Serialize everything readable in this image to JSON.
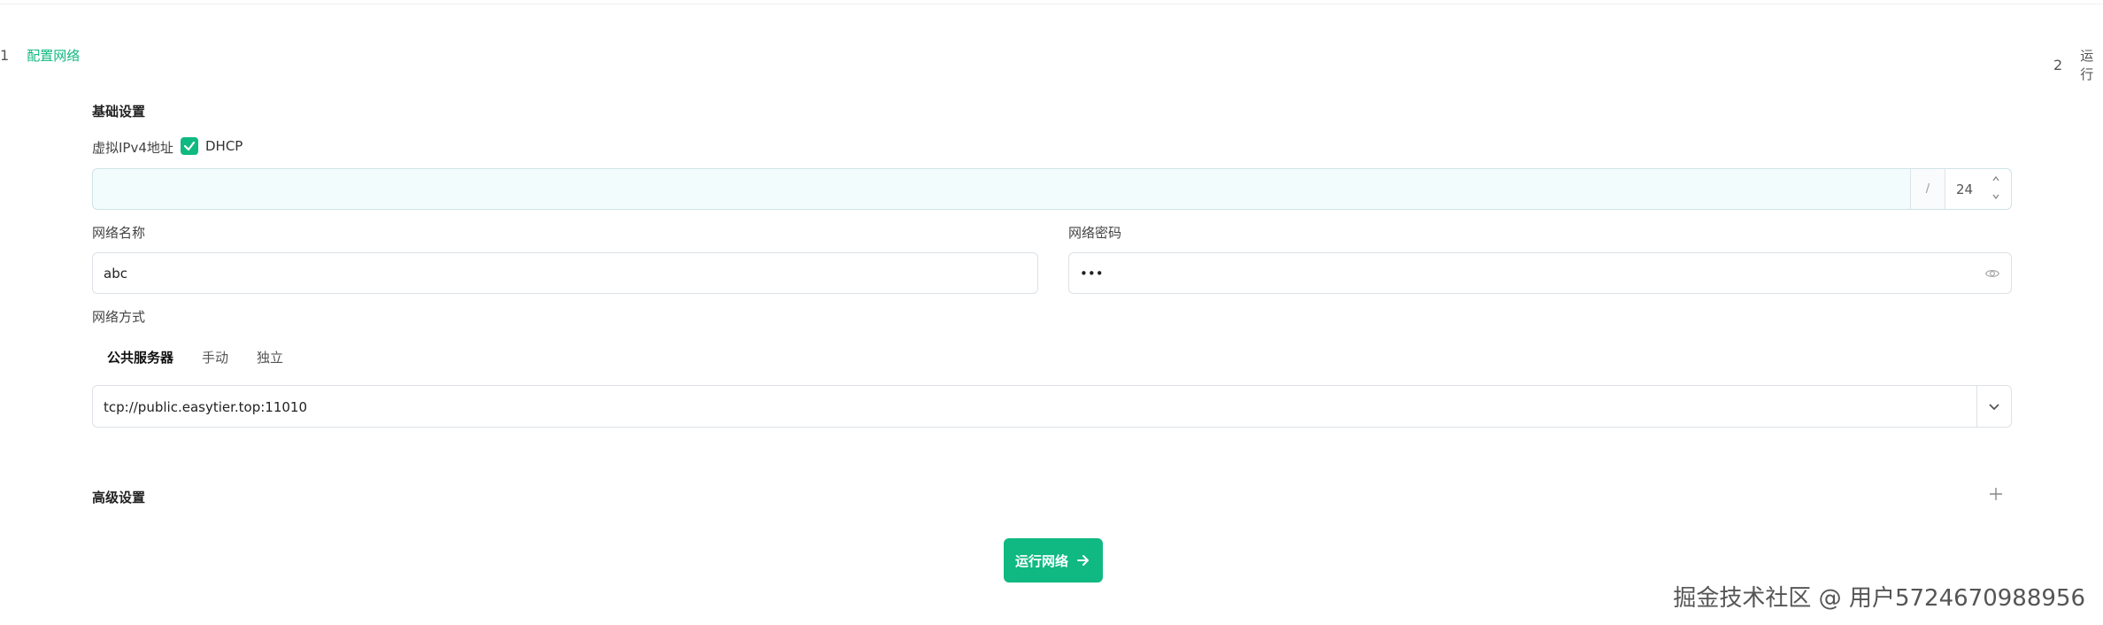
{
  "steps": [
    {
      "num": "1",
      "label": "配置网络"
    },
    {
      "num": "2",
      "label": "运行"
    }
  ],
  "basic": {
    "title": "基础设置",
    "ipv4_label": "虚拟IPv4地址",
    "dhcp_label": "DHCP",
    "dhcp_checked": true,
    "ipv4_value": "",
    "slash": "/",
    "mask_value": "24"
  },
  "network_name": {
    "label": "网络名称",
    "value": "abc"
  },
  "network_secret": {
    "label": "网络密码",
    "value": "•••"
  },
  "network_mode": {
    "label": "网络方式",
    "tabs": [
      "公共服务器",
      "手动",
      "独立"
    ],
    "active_tab": 0,
    "server": "tcp://public.easytier.top:11010"
  },
  "advanced": {
    "title": "高级设置"
  },
  "run_button": {
    "label": "运行网络"
  },
  "watermark": "掘金技术社区 @ 用户5724670988956",
  "colors": {
    "accent": "#10b981",
    "input_bg": "#f2fcfd"
  }
}
